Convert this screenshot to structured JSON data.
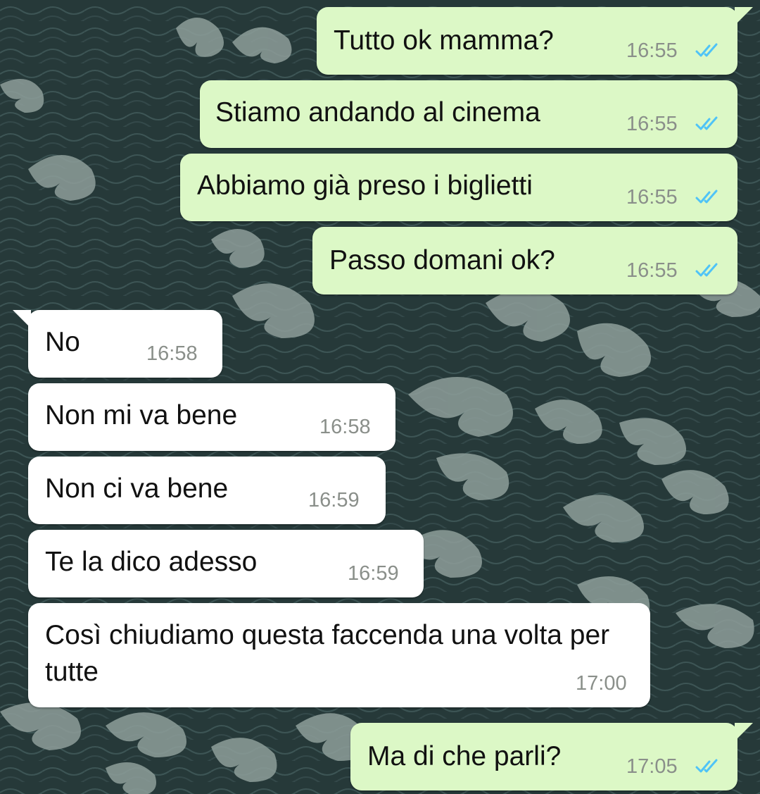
{
  "colors": {
    "wallpaper_dark": "#263939",
    "wallpaper_wave": "#8e9e9a",
    "outgoing_bubble": "#dcf8c6",
    "incoming_bubble": "#ffffff",
    "read_ticks": "#4fc3f7",
    "timestamp": "#8a8f8a"
  },
  "messages": [
    {
      "direction": "outgoing",
      "text": "Tutto ok mamma?",
      "time": "16:55",
      "status": "read-double-check-icon"
    },
    {
      "direction": "outgoing",
      "text": "Stiamo andando al cinema",
      "time": "16:55",
      "status": "read-double-check-icon"
    },
    {
      "direction": "outgoing",
      "text": "Abbiamo già preso i biglietti",
      "time": "16:55",
      "status": "read-double-check-icon"
    },
    {
      "direction": "outgoing",
      "text": "Passo domani ok?",
      "time": "16:55",
      "status": "read-double-check-icon"
    },
    {
      "direction": "incoming",
      "text": "No",
      "time": "16:58"
    },
    {
      "direction": "incoming",
      "text": "Non mi va bene",
      "time": "16:58"
    },
    {
      "direction": "incoming",
      "text": "Non ci va bene",
      "time": "16:59"
    },
    {
      "direction": "incoming",
      "text": "Te la dico adesso",
      "time": "16:59"
    },
    {
      "direction": "incoming",
      "text": "Così chiudiamo questa faccenda una volta per tutte",
      "time": "17:00"
    },
    {
      "direction": "outgoing",
      "text": "Ma di che parli?",
      "time": "17:05",
      "status": "read-double-check-icon"
    }
  ]
}
